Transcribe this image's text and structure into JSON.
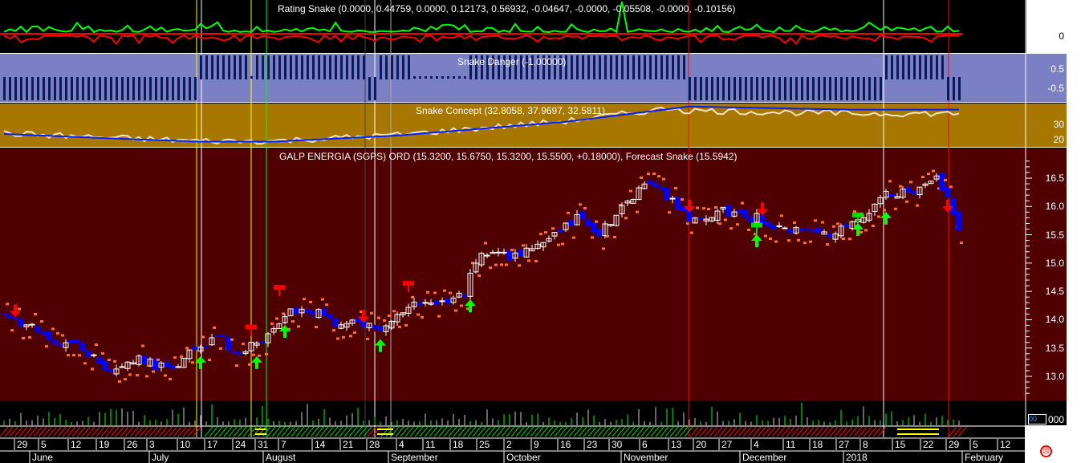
{
  "panels": {
    "rating": {
      "title": "Rating Snake (0.0000, 0.44759, 0.0000, 0.12173, 0.56932, -0.04647, -0.0000, -0.05508, -0.0000, -0.10156)",
      "axis": [
        "0"
      ]
    },
    "danger": {
      "title": "Snake Danger (-1.00000)",
      "axis": [
        "0.5",
        "-0.5"
      ]
    },
    "concept": {
      "title": "Snake Concept (32.8058, 37.9697, 32.5811)",
      "axis": [
        "30",
        "20"
      ]
    },
    "main": {
      "title": "GALP ENERGIA (SGPS) ORD (15.3200, 15.6750, 15.3200, 15.5500, +0.18000), Forecast Snake (15.5942)"
    },
    "volume": {
      "box": "00",
      "axis": "000"
    }
  },
  "colors": {
    "rating_bg": "#000000",
    "danger_bg": "#7b7fc4",
    "concept_bg": "#a87700",
    "main_bg": "#500000",
    "up": "#ffffff",
    "down": "#0000ff"
  },
  "dates": [
    "29",
    "5",
    "12",
    "19",
    "26",
    "3",
    "10",
    "17",
    "24",
    "31",
    "7",
    "14",
    "21",
    "28",
    "4",
    "11",
    "18",
    "25",
    "2",
    "9",
    "16",
    "23",
    "30",
    "6",
    "13",
    "20",
    "27",
    "4",
    "11",
    "18",
    "27",
    "8",
    "15",
    "22",
    "29",
    "5",
    "12"
  ],
  "months": [
    "June",
    "July",
    "August",
    "September",
    "October",
    "November",
    "December",
    "2018",
    "February"
  ],
  "chart_data": {
    "type": "candlestick",
    "title": "GALP ENERGIA (SGPS) ORD",
    "ylim": [
      12.6,
      16.9
    ],
    "yticks": [
      "16.5",
      "16.0",
      "15.5",
      "15.0",
      "14.5",
      "14.0",
      "13.5",
      "13.0"
    ],
    "bars": 171,
    "price_path": [
      [
        0,
        14.1
      ],
      [
        4,
        13.9
      ],
      [
        8,
        13.7
      ],
      [
        14,
        13.5
      ],
      [
        19,
        13.1
      ],
      [
        24,
        13.3
      ],
      [
        30,
        13.1
      ],
      [
        34,
        13.5
      ],
      [
        38,
        13.7
      ],
      [
        42,
        13.4
      ],
      [
        46,
        13.7
      ],
      [
        50,
        14.1
      ],
      [
        54,
        14.2
      ],
      [
        59,
        13.95
      ],
      [
        64,
        13.9
      ],
      [
        66,
        13.8
      ],
      [
        71,
        14.2
      ],
      [
        77,
        14.3
      ],
      [
        82,
        14.5
      ],
      [
        85,
        15.2
      ],
      [
        91,
        15.1
      ],
      [
        96,
        15.3
      ],
      [
        102,
        15.8
      ],
      [
        106,
        15.5
      ],
      [
        109,
        15.9
      ],
      [
        114,
        16.4
      ],
      [
        118,
        16.2
      ],
      [
        122,
        15.8
      ],
      [
        128,
        15.9
      ],
      [
        134,
        15.8
      ],
      [
        137,
        15.6
      ],
      [
        142,
        15.6
      ],
      [
        148,
        15.5
      ],
      [
        152,
        15.8
      ],
      [
        157,
        16.2
      ],
      [
        162,
        16.3
      ],
      [
        166,
        16.5
      ],
      [
        169,
        15.9
      ],
      [
        170,
        15.5
      ]
    ],
    "signals": [
      {
        "type": "sell",
        "bar": 2,
        "price": 14.1
      },
      {
        "type": "buy",
        "bar": 35,
        "price": 13.3
      },
      {
        "type": "buy",
        "bar": 45,
        "price": 13.3
      },
      {
        "type": "buy",
        "bar": 50,
        "price": 13.85
      },
      {
        "type": "sell",
        "bar": 64,
        "price": 14.0
      },
      {
        "type": "buy",
        "bar": 67,
        "price": 13.6
      },
      {
        "type": "buy",
        "bar": 83,
        "price": 14.3
      },
      {
        "type": "sell",
        "bar": 122,
        "price": 15.95
      },
      {
        "type": "sell",
        "bar": 135,
        "price": 15.9
      },
      {
        "type": "buy",
        "bar": 134,
        "price": 15.45
      },
      {
        "type": "buy",
        "bar": 152,
        "price": 15.65
      },
      {
        "type": "buy",
        "bar": 157,
        "price": 15.85
      },
      {
        "type": "sell",
        "bar": 168,
        "price": 15.95
      }
    ],
    "exits": [
      {
        "color": "red",
        "bar": 49,
        "price": 14.5
      },
      {
        "color": "red",
        "bar": 44,
        "price": 13.8
      },
      {
        "color": "red",
        "bar": 72,
        "price": 14.57
      },
      {
        "color": "green",
        "bar": 134,
        "price": 15.6
      },
      {
        "color": "green",
        "bar": 152,
        "price": 15.78
      }
    ],
    "danger_segments": [
      [
        0,
        34,
        -1
      ],
      [
        35,
        43,
        1
      ],
      [
        45,
        64,
        1
      ],
      [
        65,
        66,
        -1
      ],
      [
        67,
        72,
        1
      ],
      [
        73,
        82,
        0
      ],
      [
        83,
        122,
        1
      ],
      [
        122,
        156,
        -1
      ],
      [
        157,
        168,
        1
      ],
      [
        168,
        170,
        -1
      ]
    ],
    "concept_trend": [
      [
        0,
        24
      ],
      [
        20,
        21
      ],
      [
        35,
        19
      ],
      [
        48,
        19
      ],
      [
        70,
        23
      ],
      [
        100,
        32
      ],
      [
        122,
        42
      ],
      [
        150,
        40
      ],
      [
        170,
        40
      ]
    ],
    "concept_ylim": [
      15.6,
      44.5
    ]
  }
}
